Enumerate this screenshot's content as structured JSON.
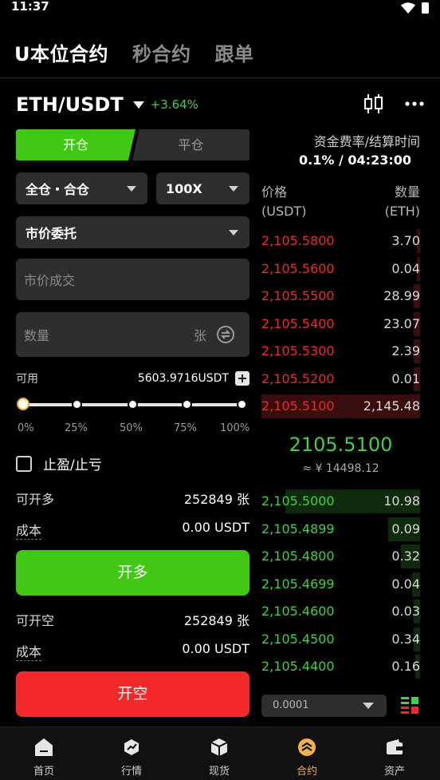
{
  "status": {
    "time": "11:37"
  },
  "top_tabs": [
    {
      "label": "U本位合约",
      "active": true
    },
    {
      "label": "秒合约",
      "active": false
    },
    {
      "label": "跟单",
      "active": false
    }
  ],
  "pair": {
    "name": "ETH/USDT",
    "change": "+3.64%"
  },
  "side_tabs": {
    "open": "开仓",
    "close": "平仓"
  },
  "margin_mode": "全仓・合仓",
  "leverage": "100X",
  "order_type": "市价委托",
  "price_input": {
    "placeholder": "市价成交"
  },
  "amount_input": {
    "placeholder": "数量",
    "unit": "张"
  },
  "available": {
    "label": "可用",
    "value": "5603.9716USDT"
  },
  "slider": {
    "value_percent": 0,
    "labels": [
      "0%",
      "25%",
      "50%",
      "75%",
      "100%"
    ]
  },
  "tp_sl": {
    "label": "止盈/止亏",
    "checked": false
  },
  "long": {
    "max_label": "可开多",
    "max_value": "252849 张",
    "cost_label": "成本",
    "cost_value": "0.00 USDT",
    "button": "开多"
  },
  "short": {
    "max_label": "可开空",
    "max_value": "252849 张",
    "cost_label": "成本",
    "cost_value": "0.00 USDT",
    "button": "开空"
  },
  "funding": {
    "label": "资金费率/结算时间",
    "value": "0.1% / 04:23:00"
  },
  "orderbook": {
    "price_header": [
      "价格",
      "(USDT)"
    ],
    "qty_header": [
      "数量",
      "(ETH)"
    ],
    "asks": [
      {
        "price": "2,105.5800",
        "qty": "3.70",
        "depth": 0.02
      },
      {
        "price": "2,105.5600",
        "qty": "0.04",
        "depth": 0.02
      },
      {
        "price": "2,105.5500",
        "qty": "28.99",
        "depth": 0.04
      },
      {
        "price": "2,105.5400",
        "qty": "23.07",
        "depth": 0.04
      },
      {
        "price": "2,105.5300",
        "qty": "2.39",
        "depth": 0.04
      },
      {
        "price": "2,105.5200",
        "qty": "0.01",
        "depth": 0.04
      },
      {
        "price": "2,105.5100",
        "qty": "2,145.48",
        "depth": 1.0
      }
    ],
    "mid_price": "2105.5100",
    "mid_cny": "≈ ¥ 14498.12",
    "bids": [
      {
        "price": "2,105.5000",
        "qty": "10.98",
        "depth": 0.85
      },
      {
        "price": "2,105.4899",
        "qty": "0.09",
        "depth": 0.2
      },
      {
        "price": "2,105.4800",
        "qty": "0.32",
        "depth": 0.12
      },
      {
        "price": "2,105.4699",
        "qty": "0.04",
        "depth": 0.05
      },
      {
        "price": "2,105.4600",
        "qty": "0.03",
        "depth": 0.04
      },
      {
        "price": "2,105.4500",
        "qty": "0.34",
        "depth": 0.04
      },
      {
        "price": "2,105.4400",
        "qty": "0.16",
        "depth": 0.03
      }
    ],
    "precision": "0.0001"
  },
  "nav": [
    {
      "label": "首页",
      "icon": "home-icon",
      "active": false
    },
    {
      "label": "行情",
      "icon": "market-icon",
      "active": false
    },
    {
      "label": "现货",
      "icon": "spot-icon",
      "active": false
    },
    {
      "label": "合约",
      "icon": "contract-icon",
      "active": true
    },
    {
      "label": "资产",
      "icon": "wallet-icon",
      "active": false
    }
  ],
  "colors": {
    "green": "#41c814",
    "red": "#f2282a",
    "accent": "#f0b24a",
    "bg": "#000000",
    "panel": "#2e2e2e"
  }
}
